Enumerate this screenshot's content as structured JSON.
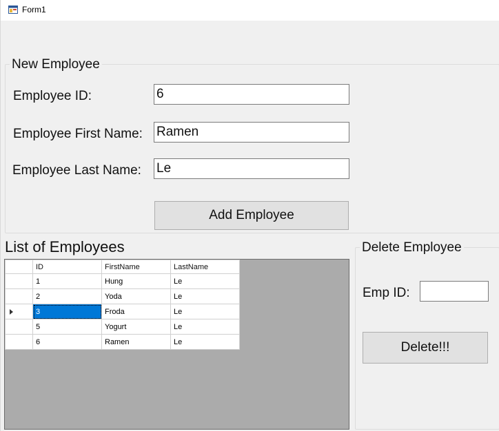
{
  "window": {
    "title": "Form1"
  },
  "new_employee": {
    "group_title": "New Employee",
    "employee_id_label": "Employee ID:",
    "employee_id_value": "6",
    "first_name_label": "Employee First Name:",
    "first_name_value": "Ramen",
    "last_name_label": "Employee Last Name:",
    "last_name_value": "Le",
    "add_button_label": "Add Employee"
  },
  "employee_list": {
    "title": "List of Employees",
    "columns": [
      "ID",
      "FirstName",
      "LastName"
    ],
    "rows": [
      {
        "id": "1",
        "first": "Hung",
        "last": "Le"
      },
      {
        "id": "2",
        "first": "Yoda",
        "last": "Le"
      },
      {
        "id": "3",
        "first": "Froda",
        "last": "Le"
      },
      {
        "id": "5",
        "first": "Yogurt",
        "last": "Le"
      },
      {
        "id": "6",
        "first": "Ramen",
        "last": "Le"
      }
    ],
    "selected_row_index": 2
  },
  "delete_employee": {
    "group_title": "Delete Employee",
    "emp_id_label": "Emp ID:",
    "emp_id_value": "",
    "delete_button_label": "Delete!!!"
  },
  "colors": {
    "selection": "#0078d7",
    "grid_background": "#ababab",
    "form_background": "#f0f0f0"
  }
}
